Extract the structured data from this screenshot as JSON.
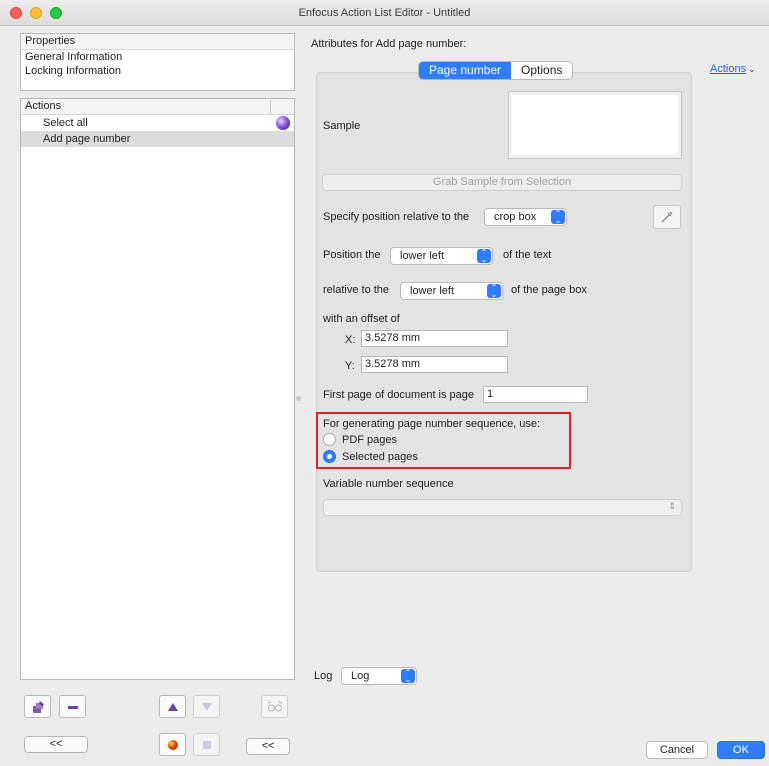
{
  "window": {
    "title": "Enfocus Action List Editor - Untitled"
  },
  "properties": {
    "header": "Properties",
    "items": [
      "General Information",
      "Locking Information"
    ]
  },
  "actions_list": {
    "header": "Actions",
    "items": [
      {
        "label": "Select all",
        "selected": false
      },
      {
        "label": "Add page number",
        "selected": true
      }
    ]
  },
  "left_toolbar": {
    "collapse_label": "<<",
    "collapse_label_2": "<<",
    "icons": [
      "edit-icon",
      "remove-icon",
      "move-up-icon",
      "move-down-icon",
      "glasses-icon",
      "record-icon",
      "stop-icon"
    ]
  },
  "attributes": {
    "title": "Attributes for Add page number:",
    "tabs": [
      {
        "label": "Page number",
        "active": true
      },
      {
        "label": "Options",
        "active": false
      }
    ],
    "actions_menu": "Actions",
    "sample_label": "Sample",
    "grab_button": "Grab Sample from Selection",
    "position_relative_label": "Specify position relative to the",
    "position_relative_value": "crop box",
    "position_the_label": "Position the",
    "position_the_value": "lower left",
    "of_text_label": "of the text",
    "relative_to_label": "relative to the",
    "relative_to_value": "lower left",
    "of_page_box_label": "of the page box",
    "offset_label": "with an offset of",
    "x_label": "X:",
    "x_value": "3.5278 mm",
    "y_label": "Y:",
    "y_value": "3.5278 mm",
    "first_page_label": "First page of document is page",
    "first_page_value": "1",
    "sequence_label": "For generating page number sequence, use:",
    "sequence_options": [
      {
        "label": "PDF pages",
        "selected": false
      },
      {
        "label": "Selected pages",
        "selected": true
      }
    ],
    "variable_sequence_label": "Variable number sequence",
    "variable_sequence_value": ""
  },
  "log": {
    "label": "Log",
    "value": "Log"
  },
  "footer": {
    "cancel": "Cancel",
    "ok": "OK"
  },
  "colors": {
    "accent": "#2f7dfa",
    "highlight_box": "#dd1f26"
  }
}
